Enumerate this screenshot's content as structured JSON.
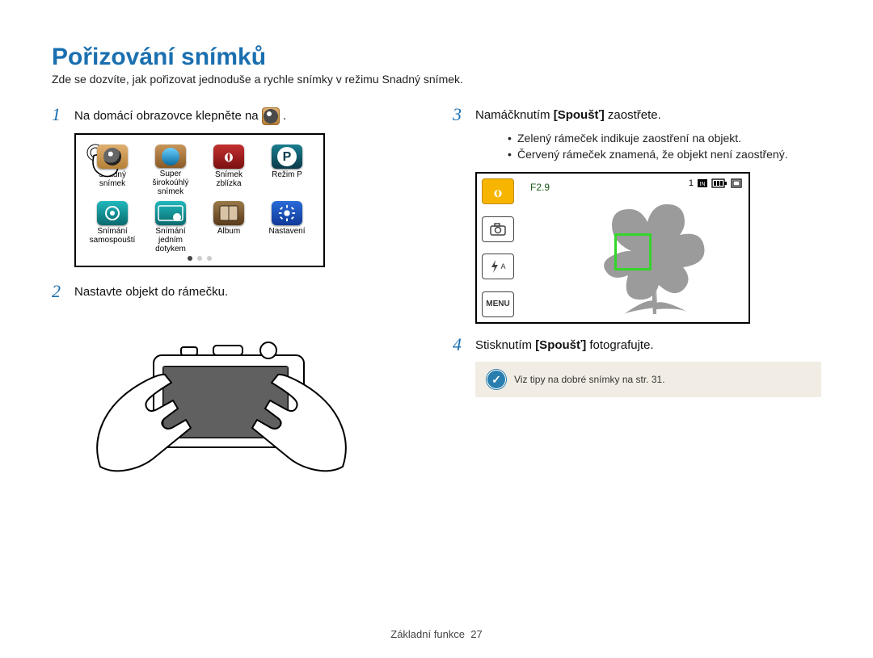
{
  "title": "Pořizování snímků",
  "intro": "Zde se dozvíte, jak pořizovat jednoduše a rychle snímky v režimu Snadný snímek.",
  "left": {
    "step1_pre": "Na domácí obrazovce klepněte na ",
    "step1_post": ".",
    "apps": [
      {
        "label_l1": "Snadný",
        "label_l2": "snímek"
      },
      {
        "label_l1": "Super širokoúhlý",
        "label_l2": "snímek"
      },
      {
        "label_l1": "Snímek",
        "label_l2": "zblízka"
      },
      {
        "label_l1": "Režim P",
        "label_l2": ""
      },
      {
        "label_l1": "Snímání",
        "label_l2": "samospouští"
      },
      {
        "label_l1": "Snímání jedním",
        "label_l2": "dotykem"
      },
      {
        "label_l1": "Album",
        "label_l2": ""
      },
      {
        "label_l1": "Nastavení",
        "label_l2": ""
      }
    ],
    "step2_text": "Nastavte objekt do rámečku."
  },
  "right": {
    "step3_pre": "Namáčknutím ",
    "step3_bold": "[Spoušť]",
    "step3_post": " zaostřete.",
    "bullets": [
      "Zelený rámeček indikuje zaostření na objekt.",
      "Červený rámeček znamená, že objekt není zaostřený."
    ],
    "lcd": {
      "f": "F2.9",
      "menu": "MENU",
      "count": "1",
      "flash_auto": "A"
    },
    "step4_pre": "Stisknutím ",
    "step4_bold": "[Spoušť]",
    "step4_post": " fotografujte.",
    "tip": "Viz tipy na dobré snímky na str. 31."
  },
  "footer": {
    "label": "Základní funkce",
    "page": "27"
  }
}
